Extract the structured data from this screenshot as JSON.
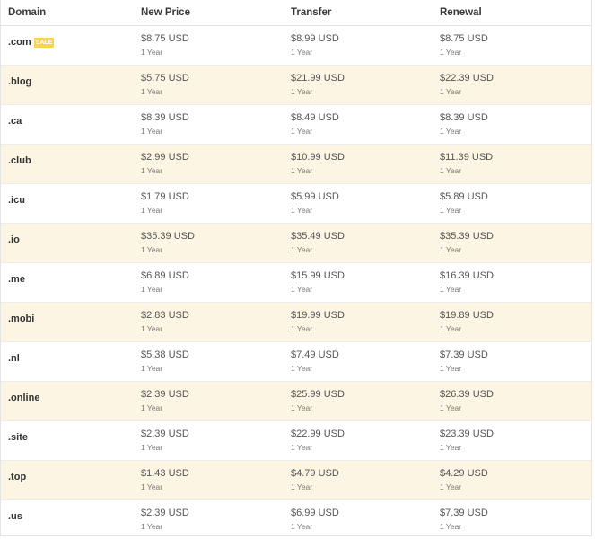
{
  "header": {
    "domain": "Domain",
    "new_price": "New Price",
    "transfer": "Transfer",
    "renewal": "Renewal"
  },
  "rows": [
    {
      "domain": ".com",
      "badge": "SALE",
      "new_price": "$8.75 USD",
      "new_period": "1 Year",
      "transfer": "$8.99 USD",
      "transfer_period": "1 Year",
      "renewal": "$8.75 USD",
      "renewal_period": "1 Year"
    },
    {
      "domain": ".blog",
      "badge": "",
      "new_price": "$5.75 USD",
      "new_period": "1 Year",
      "transfer": "$21.99 USD",
      "transfer_period": "1 Year",
      "renewal": "$22.39 USD",
      "renewal_period": "1 Year"
    },
    {
      "domain": ".ca",
      "badge": "",
      "new_price": "$8.39 USD",
      "new_period": "1 Year",
      "transfer": "$8.49 USD",
      "transfer_period": "1 Year",
      "renewal": "$8.39 USD",
      "renewal_period": "1 Year"
    },
    {
      "domain": ".club",
      "badge": "",
      "new_price": "$2.99 USD",
      "new_period": "1 Year",
      "transfer": "$10.99 USD",
      "transfer_period": "1 Year",
      "renewal": "$11.39 USD",
      "renewal_period": "1 Year"
    },
    {
      "domain": ".icu",
      "badge": "",
      "new_price": "$1.79 USD",
      "new_period": "1 Year",
      "transfer": "$5.99 USD",
      "transfer_period": "1 Year",
      "renewal": "$5.89 USD",
      "renewal_period": "1 Year"
    },
    {
      "domain": ".io",
      "badge": "",
      "new_price": "$35.39 USD",
      "new_period": "1 Year",
      "transfer": "$35.49 USD",
      "transfer_period": "1 Year",
      "renewal": "$35.39 USD",
      "renewal_period": "1 Year"
    },
    {
      "domain": ".me",
      "badge": "",
      "new_price": "$6.89 USD",
      "new_period": "1 Year",
      "transfer": "$15.99 USD",
      "transfer_period": "1 Year",
      "renewal": "$16.39 USD",
      "renewal_period": "1 Year"
    },
    {
      "domain": ".mobi",
      "badge": "",
      "new_price": "$2.83 USD",
      "new_period": "1 Year",
      "transfer": "$19.99 USD",
      "transfer_period": "1 Year",
      "renewal": "$19.89 USD",
      "renewal_period": "1 Year"
    },
    {
      "domain": ".nl",
      "badge": "",
      "new_price": "$5.38 USD",
      "new_period": "1 Year",
      "transfer": "$7.49 USD",
      "transfer_period": "1 Year",
      "renewal": "$7.39 USD",
      "renewal_period": "1 Year"
    },
    {
      "domain": ".online",
      "badge": "",
      "new_price": "$2.39 USD",
      "new_period": "1 Year",
      "transfer": "$25.99 USD",
      "transfer_period": "1 Year",
      "renewal": "$26.39 USD",
      "renewal_period": "1 Year"
    },
    {
      "domain": ".site",
      "badge": "",
      "new_price": "$2.39 USD",
      "new_period": "1 Year",
      "transfer": "$22.99 USD",
      "transfer_period": "1 Year",
      "renewal": "$23.39 USD",
      "renewal_period": "1 Year"
    },
    {
      "domain": ".top",
      "badge": "",
      "new_price": "$1.43 USD",
      "new_period": "1 Year",
      "transfer": "$4.79 USD",
      "transfer_period": "1 Year",
      "renewal": "$4.29 USD",
      "renewal_period": "1 Year"
    },
    {
      "domain": ".us",
      "badge": "",
      "new_price": "$2.39 USD",
      "new_period": "1 Year",
      "transfer": "$6.99 USD",
      "transfer_period": "1 Year",
      "renewal": "$7.39 USD",
      "renewal_period": "1 Year"
    }
  ],
  "colors": {
    "alt_row": "#fdf5e3",
    "sale_badge": "#fcd34d",
    "border": "#e4e4e4"
  }
}
